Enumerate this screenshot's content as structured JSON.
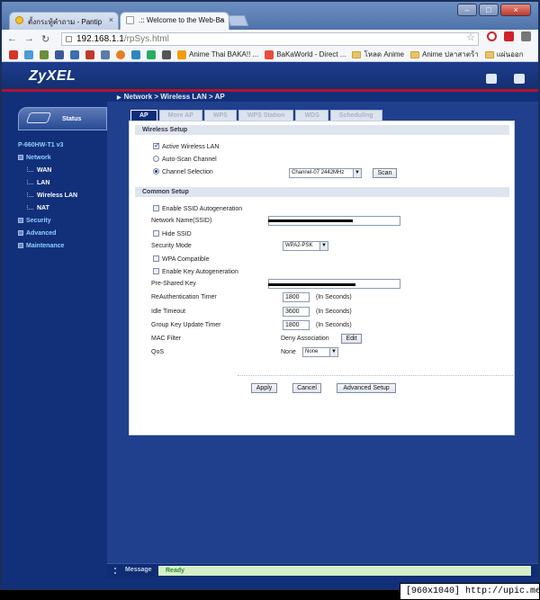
{
  "browser": {
    "tabs": [
      {
        "label": "ตั้งกระทู้คำถาม - Pantip",
        "close": "×"
      },
      {
        "label": ".:: Welcome to the Web-Ba",
        "close": "×"
      }
    ],
    "window_buttons": [
      "–",
      "□",
      "×"
    ],
    "nav": {
      "back": "←",
      "forward": "→",
      "reload": "↻"
    },
    "address": {
      "host": "192.168.1.1",
      "path": "/rpSys.html"
    },
    "star_icon": "☆",
    "bookmarks": [
      "Anime Thai BAKA!! ...",
      "BaKaWorld - Direct ...",
      "โหลด Anime",
      "Anime ปลาสาตร้า",
      "แผ่นออก"
    ]
  },
  "router": {
    "logo": "ZyXEL",
    "breadcrumb": "Network > Wireless LAN > AP",
    "status_label": "Status",
    "menu": {
      "model": "P-660HW-T1 v3",
      "network": "Network",
      "network_items": [
        "WAN",
        "LAN",
        "Wireless LAN",
        "NAT"
      ],
      "security": "Security",
      "advanced": "Advanced",
      "maintenance": "Maintenance"
    },
    "tabs": [
      "AP",
      "More AP",
      "WPS",
      "WPS Station",
      "WDS",
      "Scheduling"
    ],
    "wireless_setup": {
      "title": "Wireless Setup",
      "active_wireless_lan": "Active Wireless LAN",
      "auto_scan": "Auto-Scan Channel",
      "channel_selection": "Channel Selection",
      "channel_value": "Channel-07 2442MHz",
      "scan_button": "Scan"
    },
    "common_setup": {
      "title": "Common Setup",
      "enable_ssid_autogen": "Enable SSID Autogeneration",
      "network_name_label": "Network Name(SSID)",
      "hide_ssid": "Hide SSID",
      "security_mode_label": "Security Mode",
      "security_mode_value": "WPA2-PSK",
      "wpa_compatible": "WPA Compatible",
      "enable_key_autogen": "Enable Key Autogeneration",
      "psk_label": "Pre-Shared Key",
      "reauth_label": "ReAuthentication Timer",
      "reauth_value": "1800",
      "idle_label": "Idle Timeout",
      "idle_value": "3600",
      "group_key_label": "Group Key Update Timer",
      "group_key_value": "1800",
      "in_seconds": "(In Seconds)",
      "mac_filter_label": "MAC Filter",
      "mac_filter_value": "Deny Association",
      "edit_button": "Edit",
      "qos_label": "QoS",
      "qos_value": "None",
      "qos_select": "None"
    },
    "buttons": {
      "apply": "Apply",
      "cancel": "Cancel",
      "advanced_setup": "Advanced Setup"
    },
    "message": {
      "label": "Message",
      "value": "Ready"
    }
  },
  "watermark": "[960x1040] http://upic.me/"
}
